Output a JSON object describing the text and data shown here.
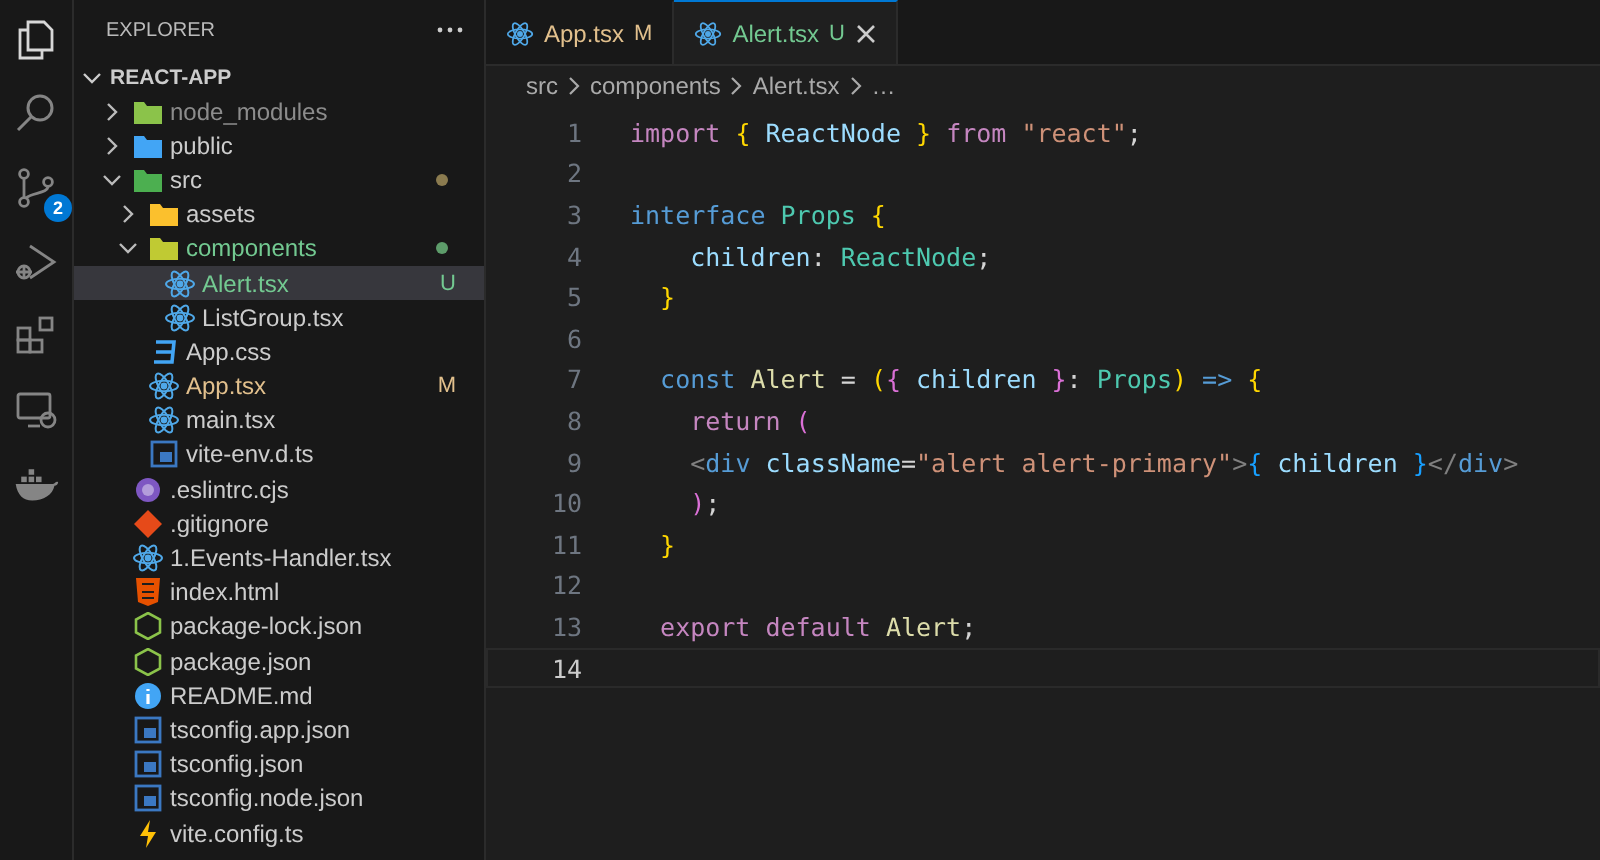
{
  "activity_bar": [
    {
      "kind": "files",
      "selected": true
    },
    {
      "kind": "search",
      "selected": false
    },
    {
      "kind": "source-control",
      "selected": false,
      "badge": "2"
    },
    {
      "kind": "run-debug",
      "selected": false
    },
    {
      "kind": "extensions",
      "selected": false
    },
    {
      "kind": "remote",
      "selected": false
    },
    {
      "kind": "docker",
      "selected": false
    }
  ],
  "explorer": {
    "title": "EXPLORER",
    "root": {
      "label": "REACT-APP",
      "expanded": true
    },
    "tree": [
      {
        "label": "node_modules",
        "kind": "folder-node",
        "expanded": false,
        "color": "#8c8c8c",
        "selected": false
      },
      {
        "label": "public",
        "kind": "folder-public",
        "expanded": false,
        "color": "#cccccc",
        "selected": false
      },
      {
        "label": "src",
        "kind": "folder-src",
        "expanded": true,
        "color": "#cccccc",
        "dot": {
          "color": "#8b7b4f"
        },
        "selected": false,
        "children": [
          {
            "label": "assets",
            "kind": "folder-assets",
            "expanded": false,
            "color": "#cccccc",
            "selected": false
          },
          {
            "label": "components",
            "kind": "folder-components",
            "expanded": true,
            "color": "#73c991",
            "dot": {
              "color": "#5d9c6a"
            },
            "selected": false,
            "children": [
              {
                "label": "Alert.tsx",
                "kind": "react",
                "color": "#73c991",
                "badge": "U",
                "selected": true
              },
              {
                "label": "ListGroup.tsx",
                "kind": "react",
                "color": "#cccccc",
                "selected": false
              }
            ]
          },
          {
            "label": "App.css",
            "kind": "css",
            "color": "#cccccc",
            "selected": false
          },
          {
            "label": "App.tsx",
            "kind": "react",
            "color": "#e2c08d",
            "badge": "M",
            "selected": false
          },
          {
            "label": "main.tsx",
            "kind": "react",
            "color": "#cccccc",
            "selected": false
          },
          {
            "label": "vite-env.d.ts",
            "kind": "typescript",
            "color": "#cccccc",
            "selected": false
          }
        ]
      },
      {
        "label": ".eslintrc.cjs",
        "kind": "eslint",
        "color": "#cccccc",
        "selected": false
      },
      {
        "label": ".gitignore",
        "kind": "git",
        "color": "#cccccc",
        "selected": false
      },
      {
        "label": "1.Events-Handler.tsx",
        "kind": "react",
        "color": "#cccccc",
        "selected": false
      },
      {
        "label": "index.html",
        "kind": "html",
        "color": "#cccccc",
        "selected": false
      },
      {
        "label": "package-lock.json",
        "kind": "nodejs",
        "color": "#cccccc",
        "selected": false
      },
      {
        "label": "package.json",
        "kind": "nodejs",
        "color": "#cccccc",
        "selected": false
      },
      {
        "label": "README.md",
        "kind": "info",
        "color": "#cccccc",
        "selected": false
      },
      {
        "label": "tsconfig.app.json",
        "kind": "tsconfig",
        "color": "#cccccc",
        "selected": false
      },
      {
        "label": "tsconfig.json",
        "kind": "tsconfig",
        "color": "#cccccc",
        "selected": false
      },
      {
        "label": "tsconfig.node.json",
        "kind": "tsconfig",
        "color": "#cccccc",
        "selected": false
      },
      {
        "label": "vite.config.ts",
        "kind": "vite",
        "color": "#cccccc",
        "selected": false
      }
    ]
  },
  "tabs": [
    {
      "label": "App.tsx",
      "badge": "M",
      "color": "#e2c08d",
      "selected": false
    },
    {
      "label": "Alert.tsx",
      "badge": "U",
      "color": "#73c991",
      "selected": true
    }
  ],
  "breadcrumbs": [
    "src",
    "components",
    "Alert.tsx",
    "…"
  ],
  "code": [
    {
      "number": "1",
      "current": false,
      "tokens": [
        {
          "text": "import ",
          "kind": "keyword"
        },
        {
          "text": "{",
          "kind": "brace1"
        },
        {
          "text": " ReactNode ",
          "kind": "variable"
        },
        {
          "text": "}",
          "kind": "brace1"
        },
        {
          "text": " from ",
          "kind": "keyword"
        },
        {
          "text": "\"react\"",
          "kind": "string"
        },
        {
          "text": ";",
          "kind": "plain"
        }
      ]
    },
    {
      "number": "2",
      "current": false
    },
    {
      "number": "3",
      "current": false,
      "tokens": [
        {
          "text": "interface ",
          "kind": "storage"
        },
        {
          "text": "Props ",
          "kind": "type"
        },
        {
          "text": "{",
          "kind": "brace1"
        }
      ]
    },
    {
      "number": "4",
      "current": false,
      "tokens": [
        {
          "text": "    children",
          "kind": "variable"
        },
        {
          "text": ": ",
          "kind": "plain"
        },
        {
          "text": "ReactNode",
          "kind": "type"
        },
        {
          "text": ";",
          "kind": "plain"
        }
      ]
    },
    {
      "number": "5",
      "current": false,
      "tokens": [
        {
          "text": "  }",
          "kind": "brace1"
        }
      ]
    },
    {
      "number": "6",
      "current": false
    },
    {
      "number": "7",
      "current": false,
      "tokens": [
        {
          "text": "  const",
          "kind": "storage"
        },
        {
          "text": " Alert ",
          "kind": "function"
        },
        {
          "text": "= ",
          "kind": "plain"
        },
        {
          "text": "(",
          "kind": "brace1"
        },
        {
          "text": "{",
          "kind": "brace2"
        },
        {
          "text": " children ",
          "kind": "variable"
        },
        {
          "text": "}",
          "kind": "brace2"
        },
        {
          "text": ": ",
          "kind": "plain"
        },
        {
          "text": "Props",
          "kind": "type"
        },
        {
          "text": ")",
          "kind": "brace1"
        },
        {
          "text": " => ",
          "kind": "storage"
        },
        {
          "text": "{",
          "kind": "brace1"
        }
      ]
    },
    {
      "number": "8",
      "current": false,
      "tokens": [
        {
          "text": "    return",
          "kind": "keyword"
        },
        {
          "text": " (",
          "kind": "brace2"
        }
      ]
    },
    {
      "number": "9",
      "current": false,
      "tokens": [
        {
          "text": "    <",
          "kind": "tag"
        },
        {
          "text": "div",
          "kind": "storage"
        },
        {
          "text": " className",
          "kind": "variable"
        },
        {
          "text": "=",
          "kind": "plain"
        },
        {
          "text": "\"alert alert-primary\"",
          "kind": "string"
        },
        {
          "text": ">",
          "kind": "tag"
        },
        {
          "text": "{",
          "kind": "brace3"
        },
        {
          "text": " children ",
          "kind": "variable"
        },
        {
          "text": "}",
          "kind": "brace3"
        },
        {
          "text": "</",
          "kind": "tag"
        },
        {
          "text": "div",
          "kind": "storage"
        },
        {
          "text": ">",
          "kind": "tag"
        }
      ]
    },
    {
      "number": "10",
      "current": false,
      "tokens": [
        {
          "text": "    )",
          "kind": "brace2"
        },
        {
          "text": ";",
          "kind": "plain"
        }
      ]
    },
    {
      "number": "11",
      "current": false,
      "tokens": [
        {
          "text": "  }",
          "kind": "brace1"
        }
      ]
    },
    {
      "number": "12",
      "current": false
    },
    {
      "number": "13",
      "current": false,
      "tokens": [
        {
          "text": "  export default",
          "kind": "keyword"
        },
        {
          "text": " Alert",
          "kind": "function"
        },
        {
          "text": ";",
          "kind": "plain"
        }
      ]
    },
    {
      "number": "14",
      "current": true
    }
  ]
}
